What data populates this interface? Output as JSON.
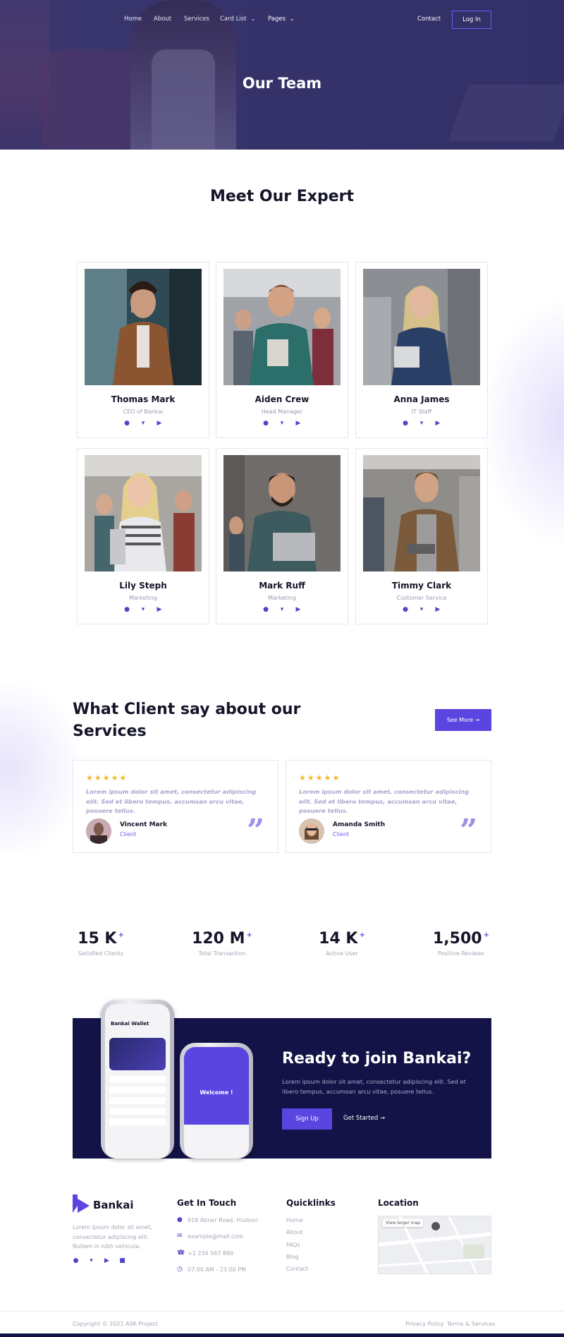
{
  "nav": {
    "items": [
      "Home",
      "About",
      "Services",
      "Card List",
      "Pages"
    ],
    "contact": "Contact",
    "login": "Log In"
  },
  "hero": {
    "title": "Our Team"
  },
  "team": {
    "title": "Meet Our Expert",
    "members": [
      {
        "name": "Thomas Mark",
        "role": "CEO of Bankai"
      },
      {
        "name": "Aiden Crew",
        "role": "Head Manager"
      },
      {
        "name": "Anna James",
        "role": "IT Staff"
      },
      {
        "name": "Lily Steph",
        "role": "Marketing"
      },
      {
        "name": "Mark Ruff",
        "role": "Marketing"
      },
      {
        "name": "Timmy Clark",
        "role": "Customer Service"
      }
    ]
  },
  "testimonials": {
    "heading": "What Client say about our Services",
    "see_more": "See More",
    "items": [
      {
        "stars": "★★★★★",
        "text": "Lorem ipsum dolor sit amet, consectetur adipiscing elit. Sed et libero tempus, accumsan arcu vitae, posuere tellus.",
        "name": "Vincent Mark",
        "role": "Client"
      },
      {
        "stars": "★★★★★",
        "text": "Lorem ipsum dolor sit amet, consectetur adipiscing elit. Sed et libero tempus, accumsan arcu vitae, posuere tellus.",
        "name": "Amanda Smith",
        "role": "Client"
      }
    ]
  },
  "stats": [
    {
      "value": "15 K",
      "label": "Satisfied Clients"
    },
    {
      "value": "120 M",
      "label": "Total Transaction"
    },
    {
      "value": "14 K",
      "label": "Active User"
    },
    {
      "value": "1,500",
      "label": "Positive Reviews"
    }
  ],
  "cta": {
    "title": "Ready to join Bankai?",
    "text": "Lorem ipsum dolor sit amet, consectetur adipiscing elit. Sed et libero tempus, accumsan arcu vitae, posuere tellus.",
    "signup": "Sign Up",
    "get_started": "Get Started",
    "phone_app_title": "Bankai Wallet",
    "phone_welcome": "Welcome !"
  },
  "footer": {
    "brand": "Bankai",
    "about": "Lorem ipsum dolor sit amet, consectetur adipiscing elit. Nullam in nibh vehicula.",
    "contact_title": "Get In Touch",
    "address": "918 Abner Road, Hudson",
    "email": "example@mail.com",
    "phone": "+1 234 567 890",
    "hours": "07.00 AM - 23.00 PM",
    "links_title": "Quicklinks",
    "links": [
      "Home",
      "About",
      "FAQs",
      "Blog",
      "Contact"
    ],
    "location_title": "Location",
    "map_button": "View larger map",
    "copyright": "Copyright © 2021 ASK Project",
    "privacy": "Privacy Policy",
    "terms": "Terms & Services"
  },
  "colors": {
    "accent": "#5b45e0",
    "navy": "#141347",
    "star": "#f4b52a"
  }
}
